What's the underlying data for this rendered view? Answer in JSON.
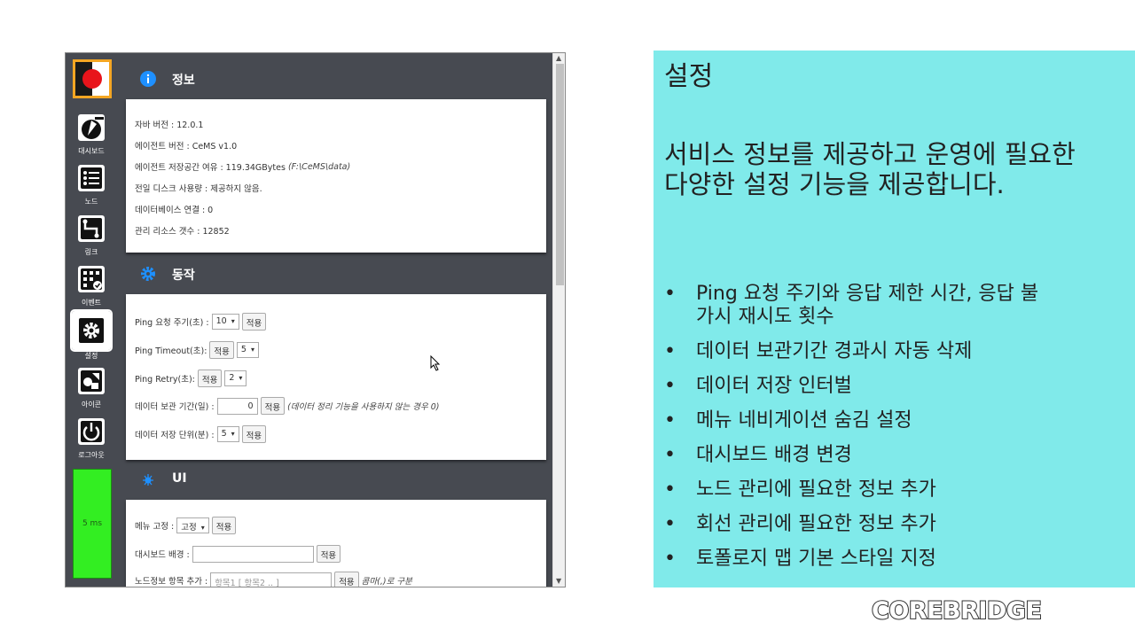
{
  "sidebar": {
    "items": [
      {
        "label": "대시보드",
        "icon": "dashboard-icon"
      },
      {
        "label": "노드",
        "icon": "list-icon"
      },
      {
        "label": "링크",
        "icon": "link-icon"
      },
      {
        "label": "이벤트",
        "icon": "event-grid-icon"
      },
      {
        "label": "설정",
        "icon": "gear-icon"
      },
      {
        "label": "아이콘",
        "icon": "shapes-icon"
      },
      {
        "label": "로그아웃",
        "icon": "power-icon"
      }
    ],
    "ping": "5 ms"
  },
  "info": {
    "title": "정보",
    "rows": [
      "자바 버전 : 12.0.1",
      "에이전트 버전 : CeMS v1.0",
      "에이전트 저장공간 여유 : 119.34GBytes",
      "전일 디스크 사용량 : 제공하지 않음.",
      "데이터베이스 연결 : 0",
      "관리 리소스 갯수 : 12852"
    ],
    "storage_path": "(F:\\CeMS\\data)"
  },
  "action": {
    "title": "동작",
    "ping_period_label": "Ping 요청 주기(초) :",
    "ping_period_value": "10",
    "ping_timeout_label": "Ping Timeout(초):",
    "ping_timeout_value": "5",
    "ping_retry_label": "Ping Retry(초):",
    "ping_retry_value": "2",
    "retention_label": "데이터 보관 기간(일) :",
    "retention_value": "0",
    "retention_note": "(데이터 정리 기능을 사용하지 않는 경우 0)",
    "interval_label": "데이터 저장 단위(분) :",
    "interval_value": "5",
    "apply": "적용"
  },
  "ui": {
    "title": "UI",
    "menu_fix_label": "메뉴 고정 :",
    "menu_fix_value": "고정",
    "dashboard_bg_label": "대시보드 배경 :",
    "node_info_label": "노드정보 항목 추가 :",
    "node_info_placeholder": "항목1 [ 항목2 .. ]",
    "node_info_note": "콤마(,)로 구분",
    "apply": "적용"
  },
  "panel": {
    "title": "설정",
    "description": "서비스 정보를 제공하고 운영에 필요한 다양한 설정 기능을 제공합니다.",
    "bullets": [
      "Ping 요청 주기와 응답 제한 시간, 응답 불가시 재시도 횟수",
      "데이터 보관기간 경과시 자동 삭제",
      "데이터 저장 인터벌",
      "메뉴 네비게이션 숨김 설정",
      "대시보드 배경 변경",
      "노드 관리에 필요한 정보 추가",
      "회선 관리에 필요한 정보 추가",
      "토폴로지 맵 기본 스타일 지정"
    ],
    "color": "#80eaea"
  },
  "brand": "COREBRIDGE"
}
